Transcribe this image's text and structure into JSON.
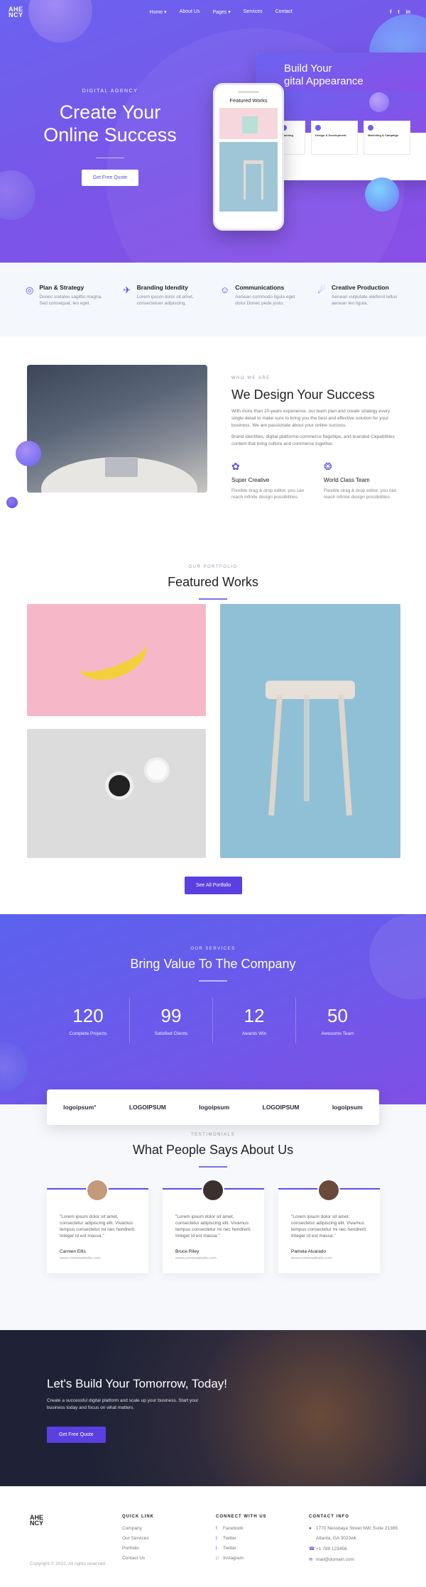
{
  "nav": {
    "logo_line1": "AHE",
    "logo_line2": "NCY",
    "items": [
      "Home ▾",
      "About Us",
      "Pages ▾",
      "Services",
      "Contact"
    ],
    "social": [
      "f",
      "t",
      "in"
    ]
  },
  "hero": {
    "eyebrow": "DIGITAL AGENCY",
    "title_line1": "Create Your",
    "title_line2": "Online Success",
    "cta": "Get Free Quote",
    "browser_title_line1": "Build Your",
    "browser_title_line2": "gital Appearance",
    "browser_cards": [
      "Planning",
      "Design & Development",
      "Marketing & Campaign"
    ],
    "phone_title": "Featured Works"
  },
  "features": [
    {
      "icon": "◎",
      "title": "Plan & Strategy",
      "text": "Donec sodales sagittis magna. Sed consequat, leo eget."
    },
    {
      "icon": "✈",
      "title": "Branding Idendity",
      "text": "Lorem ipsum dolor sit amet, consectetuer adipiscing."
    },
    {
      "icon": "☺",
      "title": "Communications",
      "text": "Aenean commodo ligula eget dolor Donec pede justo."
    },
    {
      "icon": "☄",
      "title": "Creative Production",
      "text": "Aenean vulputate eleifend tellus aenean leo ligula."
    }
  ],
  "about": {
    "eyebrow": "WHO WE ARE",
    "title": "We Design Your Success",
    "para1": "With more than 10-years experience, our team plan and create strategy every single detail to make sure to bring you the best and effective solution for your business. We are passionate about your online success.",
    "para2": "Brand identities, digital platforme-commerce flagships, and branded Capabilities content that bring culture and commerce together.",
    "features": [
      {
        "icon": "✿",
        "title": "Super Creative",
        "text": "Flexible drag & drop editor, you can reach infinite design possibilities."
      },
      {
        "icon": "❂",
        "title": "World Class Team",
        "text": "Flexible drag & drop editor, you can reach infinite design possibilities."
      }
    ]
  },
  "portfolio": {
    "eyebrow": "OUR PORTFOLIO",
    "title": "Featured Works",
    "button": "See All Portfolio"
  },
  "services": {
    "eyebrow": "OUR SERVICES",
    "title": "Bring Value To The Company",
    "stats": [
      {
        "num": "120",
        "label": "Complete Projects"
      },
      {
        "num": "99",
        "label": "Satisfied Clients"
      },
      {
        "num": "12",
        "label": "Awards Win"
      },
      {
        "num": "50",
        "label": "Awesome Team"
      }
    ]
  },
  "logos": [
    "logoipsum°",
    "LOGOIPSUM",
    "logoipsum",
    "LOGOIPSUM",
    "logoipsum"
  ],
  "testimonials": {
    "eyebrow": "TESTIMONIALS",
    "title": "What People Says About Us",
    "items": [
      {
        "quote": "\"Lorem ipsum dolor sit amet, consectetur adipiscing elit. Vivamus tempus consectetur mi nec hendrerit. Integer id est massa.\"",
        "name": "Carmen Ellis",
        "site": "www.commaabsite.com",
        "color": "#c49a7a"
      },
      {
        "quote": "\"Lorem ipsum dolor sit amet, consectetur adipiscing elit. Vivamus tempus consectetur mi nec hendrerit. Integer id est massa.\"",
        "name": "Bruce Riley",
        "site": "www.commaabsite.com",
        "color": "#3a3030"
      },
      {
        "quote": "\"Lorem ipsum dolor sit amet, consectetur adipiscing elit. Vivamus tempus consectetur mi nec hendrerit. Integer id est massa.\"",
        "name": "Pamela Alvarado",
        "site": "www.commaabsite.com",
        "color": "#6a4a3a"
      }
    ]
  },
  "cta": {
    "title": "Let's Build Your Tomorrow, Today!",
    "text": "Create a successful digital platform and scale up your business. Start your business today and focus on what matters.",
    "button": "Get Free Quote"
  },
  "footer": {
    "logo_line1": "AHE",
    "logo_line2": "NCY",
    "quick_title": "QUICK LINK",
    "quick_links": [
      "Company",
      "Our Services",
      "Portfolio",
      "Contact Us"
    ],
    "connect_title": "CONNECT WITH US",
    "connect_links": [
      {
        "icon": "f",
        "label": "Facebook"
      },
      {
        "icon": "t",
        "label": "Twitter"
      },
      {
        "icon": "t",
        "label": "Twitter"
      },
      {
        "icon": "□",
        "label": "Instagram"
      }
    ],
    "contact_title": "CONTACT INFO",
    "address_line1": "1770 Nessbaya Street NW, Suite 21389,",
    "address_line2": "Atlanta, GA 3023wk",
    "phone": "+1 789 123456",
    "email": "mail@domain.com",
    "copyright": "Copyright © 2022, All rights reserved."
  },
  "colors": {
    "accent": "#5b4fe0",
    "hero_gradient_start": "#6a63f0",
    "hero_gradient_end": "#8a4fe6"
  }
}
